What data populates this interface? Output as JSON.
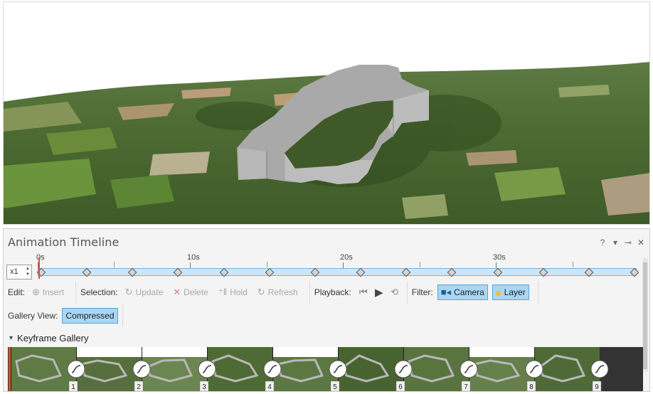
{
  "pane": {
    "title": "Animation Timeline"
  },
  "pane_controls": {
    "help": "?",
    "menu": "▾",
    "pin": "⊸",
    "close": "✕"
  },
  "ruler": {
    "labels": [
      "0s",
      "10s",
      "20s",
      "30s"
    ]
  },
  "speed": {
    "value": "x1"
  },
  "timeline": {
    "keyframe_count": 14,
    "playhead_seconds": 0
  },
  "toolbar": {
    "edit_label": "Edit:",
    "insert": "Insert",
    "selection_label": "Selection:",
    "update": "Update",
    "delete": "Delete",
    "hold": "Hold",
    "refresh": "Refresh",
    "playback_label": "Playback:",
    "filter_label": "Filter:",
    "camera": "Camera",
    "layer": "Layer"
  },
  "gallery_view": {
    "label": "Gallery View:",
    "value": "Compressed"
  },
  "gallery": {
    "title": "Keyframe Gallery",
    "thumb_numbers": [
      "1",
      "2",
      "3",
      "4",
      "5",
      "6",
      "7",
      "8",
      "9"
    ]
  },
  "colors": {
    "accent": "#d9541e",
    "track": "#cde6f7",
    "toggle_on": "#a9d6f5"
  },
  "icons": {
    "insert": "plus-circle-icon",
    "update": "refresh-arc-icon",
    "delete": "x-icon",
    "hold": "hold-icon",
    "refresh": "refresh-icon",
    "first": "skip-to-start-icon",
    "play": "play-icon",
    "loop": "loop-icon",
    "camera": "camera-icon",
    "layer": "layer-icon"
  }
}
